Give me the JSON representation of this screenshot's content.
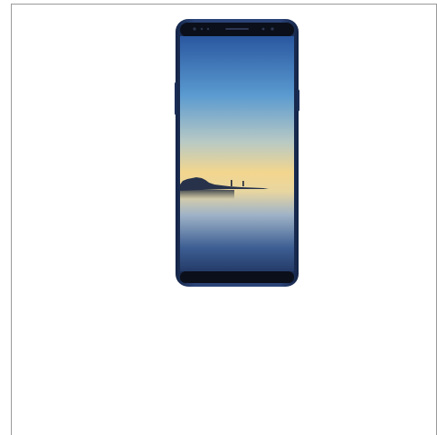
{
  "image": {
    "subject": "phone-product-photo",
    "colors": {
      "frame_border": "#9a9a9a",
      "phone_body": "#1f3560",
      "screen_top": "#2e5fa8",
      "screen_horizon": "#f2d68f",
      "screen_bottom": "#29426f"
    }
  }
}
